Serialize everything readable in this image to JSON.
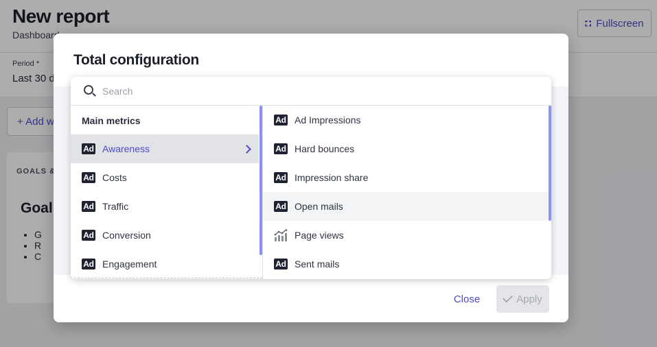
{
  "page": {
    "title": "New report",
    "subtitle": "Dashboard",
    "fullscreen_label": "Fullscreen",
    "period_label": "Period *",
    "period_value": "Last 30 d",
    "add_button": "+ Add w",
    "card_label": "GOALS &",
    "card_heading": "Goal",
    "card_bullets": [
      "G",
      "R",
      "C"
    ]
  },
  "modal": {
    "title": "Total configuration",
    "close_label": "Close",
    "apply_label": "Apply"
  },
  "search": {
    "placeholder": "Search",
    "value": ""
  },
  "left_column": {
    "heading": "Main metrics",
    "items": [
      {
        "label": "Awareness",
        "icon": "ad-icon",
        "selected": true
      },
      {
        "label": "Costs",
        "icon": "ad-icon"
      },
      {
        "label": "Traffic",
        "icon": "ad-icon"
      },
      {
        "label": "Conversion",
        "icon": "ad-icon"
      },
      {
        "label": "Engagement",
        "icon": "ad-icon"
      }
    ]
  },
  "right_column": {
    "items": [
      {
        "label": "Ad Impressions",
        "icon": "ad-icon"
      },
      {
        "label": "Hard bounces",
        "icon": "ad-icon"
      },
      {
        "label": "Impression share",
        "icon": "ad-icon"
      },
      {
        "label": "Open mails",
        "icon": "ad-icon",
        "hovered": true
      },
      {
        "label": "Page views",
        "icon": "chart-growth-icon"
      },
      {
        "label": "Sent mails",
        "icon": "ad-icon"
      }
    ]
  },
  "icons": {
    "ad_text": "Ad"
  },
  "colors": {
    "accent": "#4a4bc7",
    "scrollbar": "#8b92f0",
    "icon_bg": "#1f2230"
  }
}
